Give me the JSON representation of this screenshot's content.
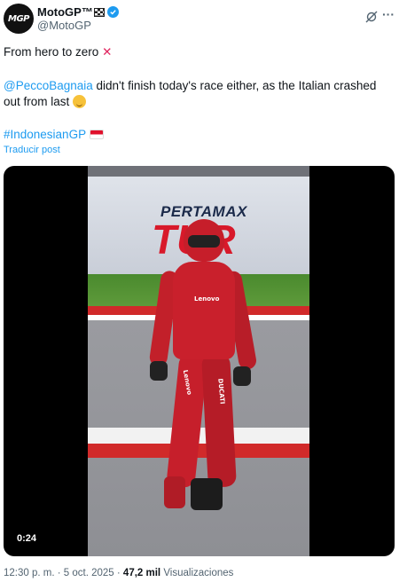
{
  "header": {
    "avatar_text": "MGP",
    "display_name": "MotoGP™",
    "handle": "@MotoGP"
  },
  "tweet": {
    "line1": "From hero to zero",
    "mention": "@PeccoBagnaia",
    "line2_rest": " didn't finish today's race either, as the Italian crashed out from last",
    "hashtag": "#IndonesianGP",
    "translate_label": "Traducir post"
  },
  "video": {
    "duration": "0:24",
    "billboard_small": "PERTAMAX",
    "billboard_big": "TUR",
    "suit_brand_1": "Lenovo",
    "suit_brand_2": "Lenovo",
    "suit_brand_3": "DUCATI"
  },
  "meta": {
    "time": "12:30 p. m.",
    "separator": " · ",
    "date": "5 oct. 2025",
    "views_count": "47,2 mil",
    "views_label": "Visualizaciones"
  },
  "icons": {
    "verified": "verified-badge-icon",
    "grok": "grok-icon",
    "more": "more-icon"
  },
  "colors": {
    "link": "#1d9bf0",
    "secondary_text": "#536471",
    "text": "#0f1419"
  }
}
